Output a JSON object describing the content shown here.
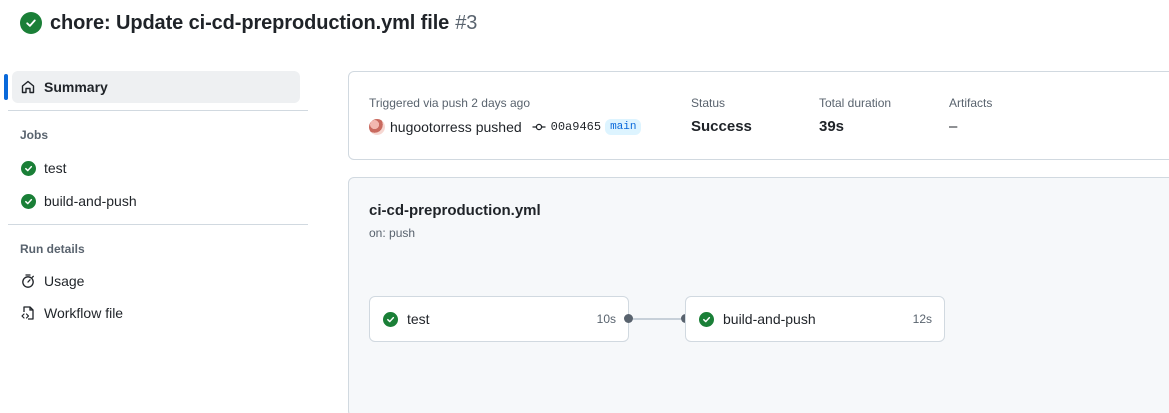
{
  "run": {
    "title": "chore: Update ci-cd-preproduction.yml file",
    "number": "#3",
    "status_color": "#1a7f37"
  },
  "sidebar": {
    "summary_label": "Summary",
    "jobs_heading": "Jobs",
    "jobs": [
      {
        "label": "test",
        "icon": "check-circle-icon"
      },
      {
        "label": "build-and-push",
        "icon": "check-circle-icon"
      }
    ],
    "run_details_heading": "Run details",
    "details": [
      {
        "label": "Usage",
        "icon": "stopwatch-icon"
      },
      {
        "label": "Workflow file",
        "icon": "file-code-icon"
      }
    ],
    "accent_color": "#0969da"
  },
  "summary": {
    "trigger_text": "Triggered via push 2 days ago",
    "user": "hugootorress",
    "action": "pushed",
    "commit_sha": "00a9465",
    "branch": "main",
    "status_label": "Status",
    "status_value": "Success",
    "duration_label": "Total duration",
    "duration_value": "39s",
    "artifacts_label": "Artifacts",
    "artifacts_value": "–"
  },
  "workflow": {
    "file_name": "ci-cd-preproduction.yml",
    "trigger": "on: push",
    "jobs": [
      {
        "name": "test",
        "duration": "10s"
      },
      {
        "name": "build-and-push",
        "duration": "12s"
      }
    ]
  }
}
